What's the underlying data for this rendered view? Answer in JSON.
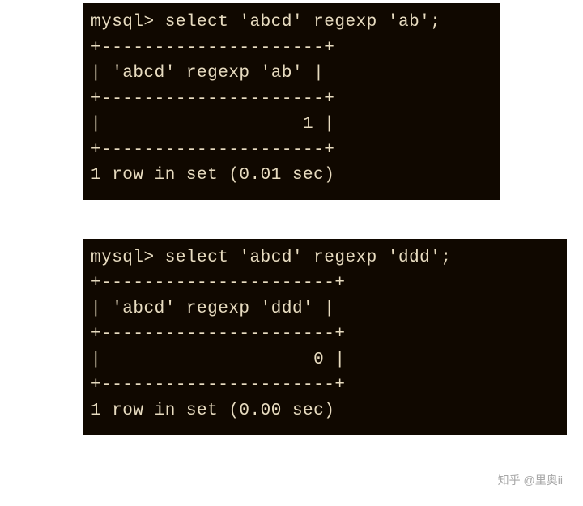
{
  "terminals": [
    {
      "prompt": "mysql>",
      "query": "select 'abcd' regexp 'ab';",
      "border_top": "+---------------------+",
      "column_header": "| 'abcd' regexp 'ab' |",
      "border_mid1": "+---------------------+",
      "result_row": "|                   1 |",
      "border_bottom": "+---------------------+",
      "status": "1 row in set (0.01 sec)"
    },
    {
      "prompt": "mysql>",
      "query": "select 'abcd' regexp 'ddd';",
      "border_top": "+----------------------+",
      "column_header": "| 'abcd' regexp 'ddd' |",
      "border_mid1": "+----------------------+",
      "result_row": "|                    0 |",
      "border_bottom": "+----------------------+",
      "status": "1 row in set (0.00 sec)"
    }
  ],
  "watermark": "知乎 @里奥ii"
}
